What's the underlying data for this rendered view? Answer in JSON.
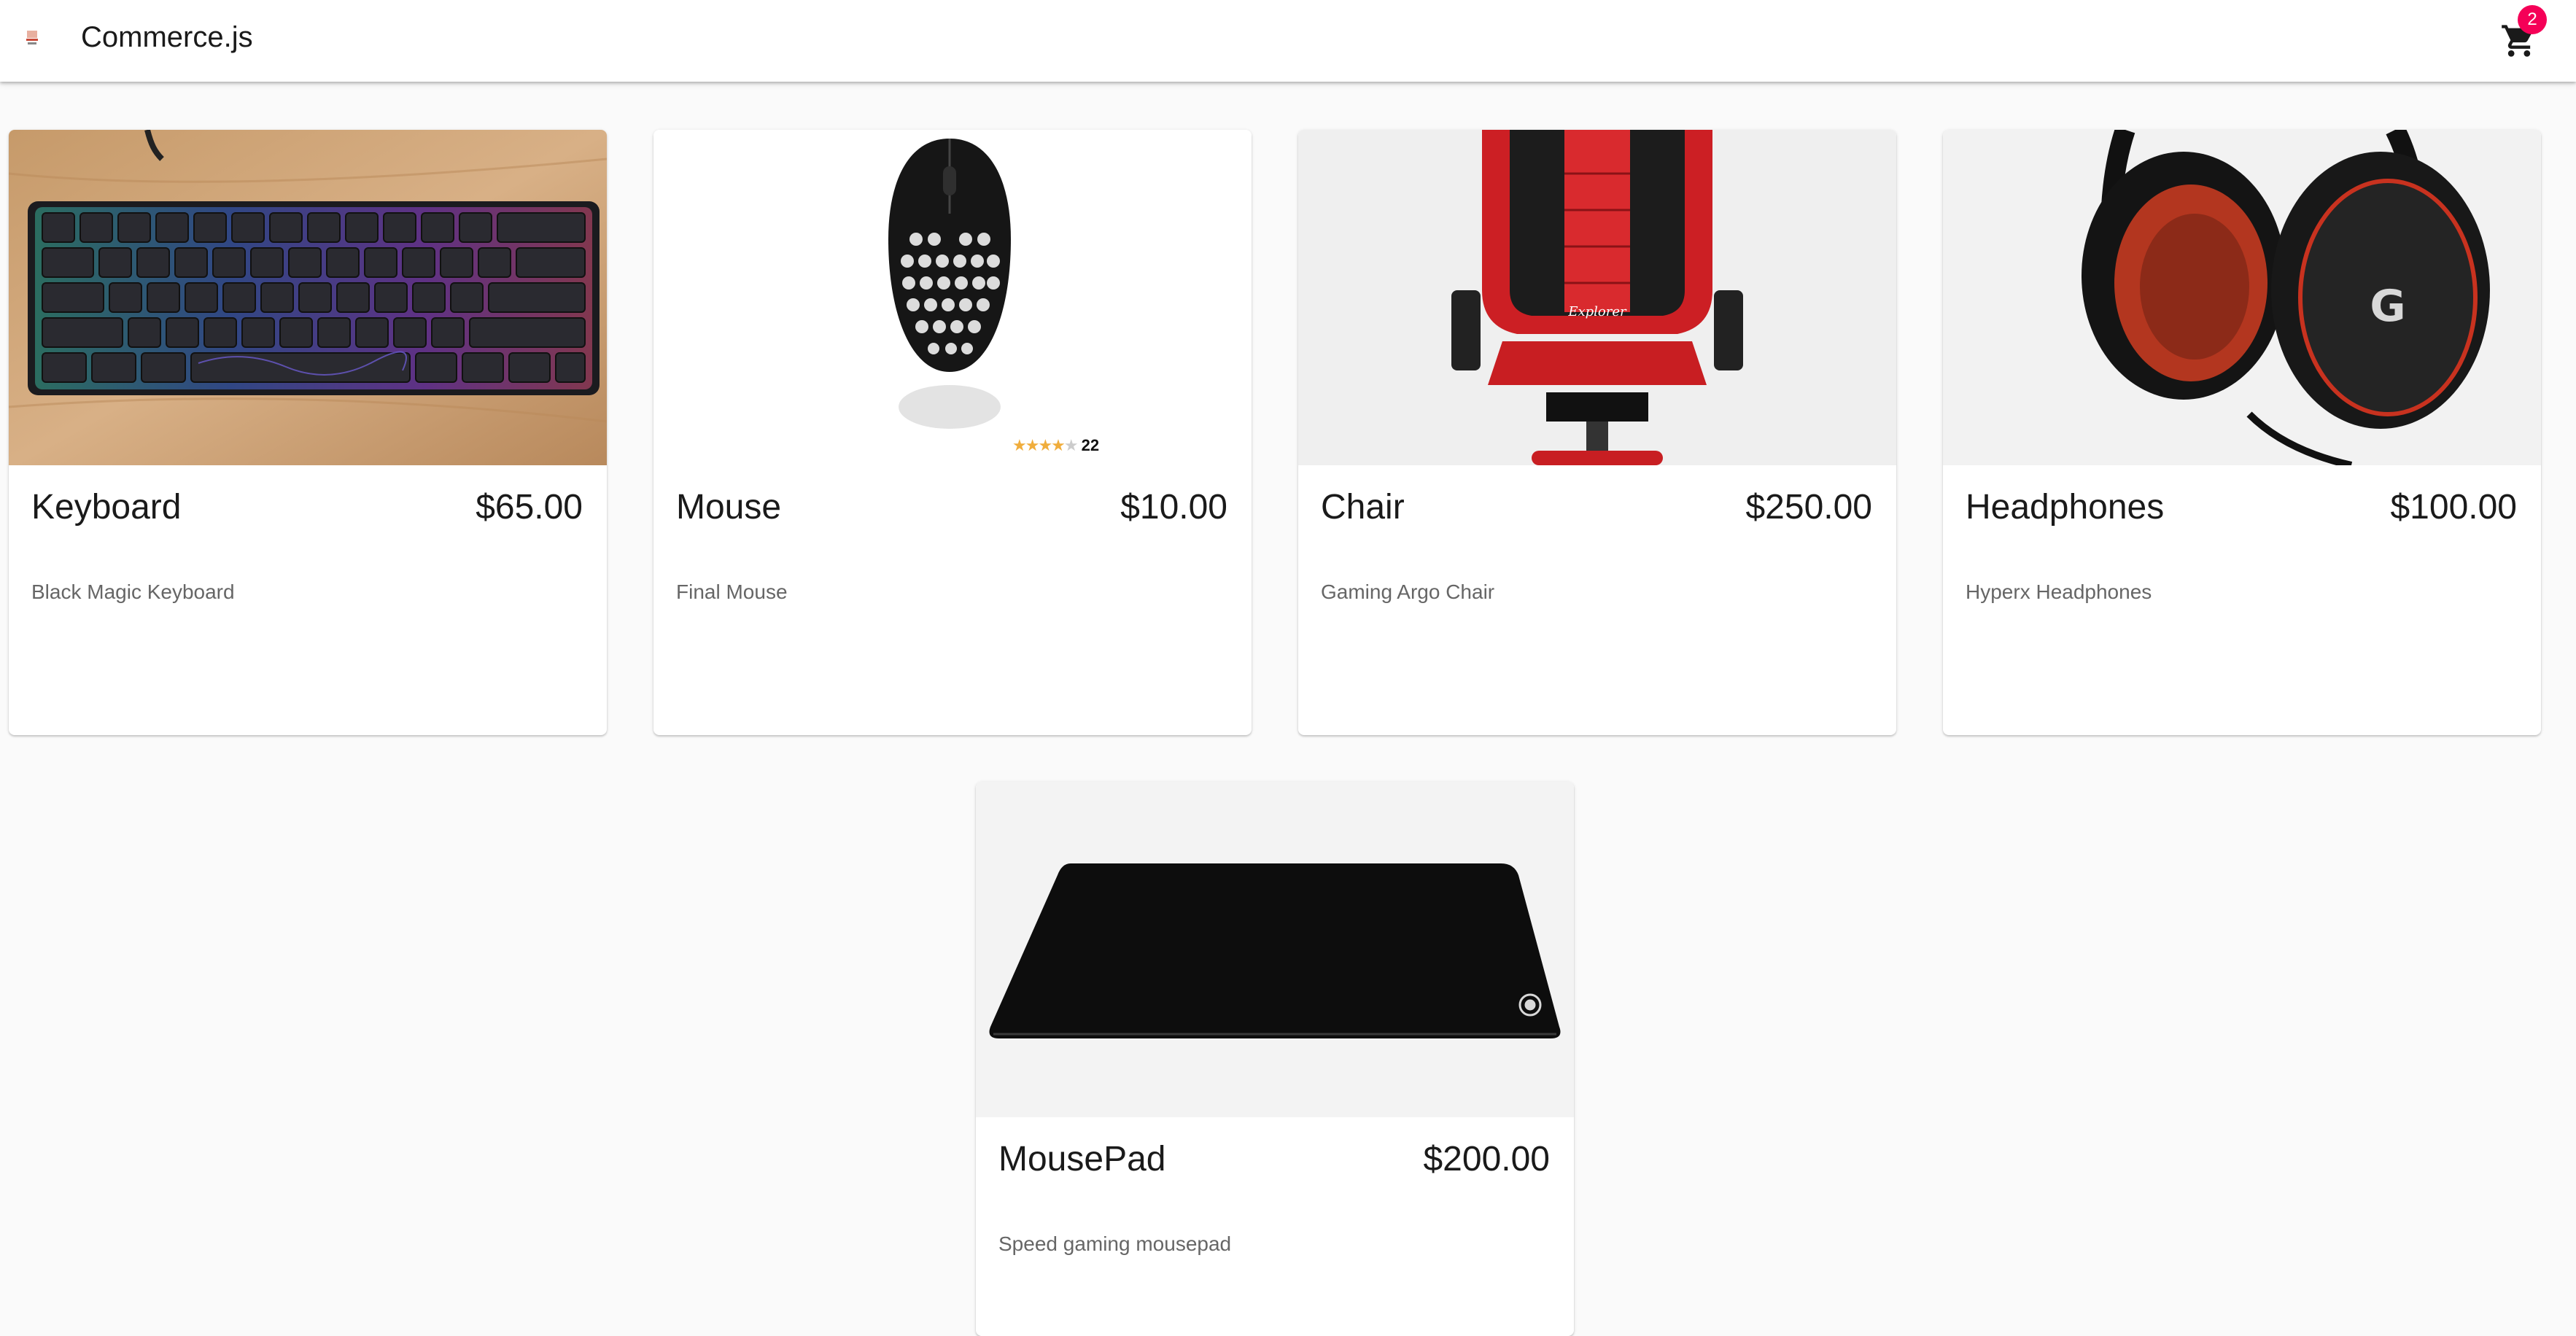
{
  "app": {
    "title": "Commerce.js"
  },
  "cart": {
    "count": "2",
    "accent": "#f50057"
  },
  "products": [
    {
      "name": "Keyboard",
      "price": "$65.00",
      "description": "Black Magic Keyboard",
      "icon": "add-shopping-cart-icon"
    },
    {
      "name": "Mouse",
      "price": "$10.00",
      "description": "Final Mouse",
      "icon": "add-shopping-cart-icon",
      "rating": {
        "stars": 4,
        "max": 5,
        "count": "22"
      }
    },
    {
      "name": "Chair",
      "price": "$250.00",
      "description": "Gaming Argo Chair",
      "icon": "add-shopping-cart-icon"
    },
    {
      "name": "Headphones",
      "price": "$100.00",
      "description": "Hyperx Headphones",
      "icon": "add-shopping-cart-icon"
    },
    {
      "name": "MousePad",
      "price": "$200.00",
      "description": "Speed gaming mousepad",
      "icon": "add-shopping-cart-icon"
    }
  ]
}
